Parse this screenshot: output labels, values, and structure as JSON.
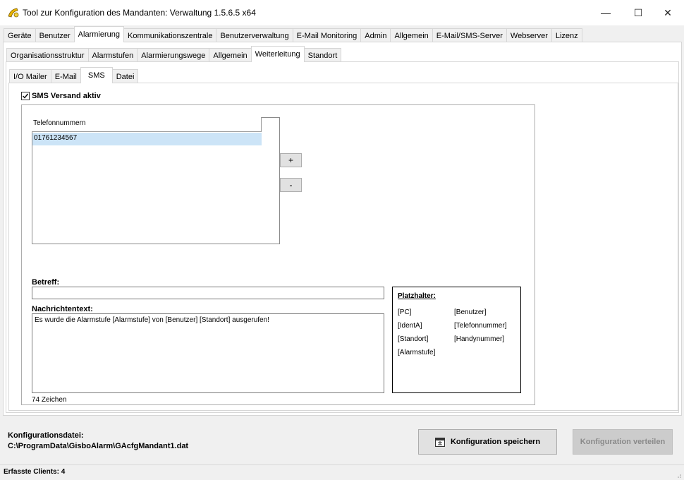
{
  "window": {
    "title": "Tool zur Konfiguration des Mandanten: Verwaltung 1.5.6.5 x64",
    "minimize": "—",
    "maximize": "☐",
    "close": "✕"
  },
  "main_tabs": [
    "Geräte",
    "Benutzer",
    "Alarmierung",
    "Kommunikationszentrale",
    "Benutzerverwaltung",
    "E-Mail Monitoring",
    "Admin",
    "Allgemein",
    "E-Mail/SMS-Server",
    "Webserver",
    "Lizenz"
  ],
  "sub_tabs": [
    "Organisationsstruktur",
    "Alarmstufen",
    "Alarmierungswege",
    "Allgemein",
    "Weiterleitung",
    "Standort"
  ],
  "channel_tabs": [
    "I/O Mailer",
    "E-Mail",
    "SMS",
    "Datei"
  ],
  "sms": {
    "active_checkbox_label": "SMS Versand aktiv",
    "active_checked": true,
    "list_header": "Telefonnummern",
    "numbers": [
      "01761234567"
    ],
    "add_label": "+",
    "remove_label": "-",
    "subject_label": "Betreff:",
    "subject_value": "",
    "message_label": "Nachrichtentext:",
    "message_value": "Es wurde die Alarmstufe [Alarmstufe] von [Benutzer] [Standort] ausgerufen!",
    "char_count": "74 Zeichen"
  },
  "placeholders": {
    "title": "Platzhalter:",
    "col1": [
      "[PC]",
      "[IdentA]",
      "[Standort]",
      "[Alarmstufe]"
    ],
    "col2": [
      "[Benutzer]",
      "[Telefonnummer]",
      "[Handynummer]"
    ]
  },
  "footer": {
    "config_file_label": "Konfigurationsdatei:",
    "config_file_path": "C:\\ProgramData\\GisboAlarm\\GAcfgMandant1.dat",
    "save_button": "Konfiguration speichern",
    "distribute_button": "Konfiguration verteilen"
  },
  "statusbar": {
    "clients": "Erfasste Clients: 4"
  }
}
